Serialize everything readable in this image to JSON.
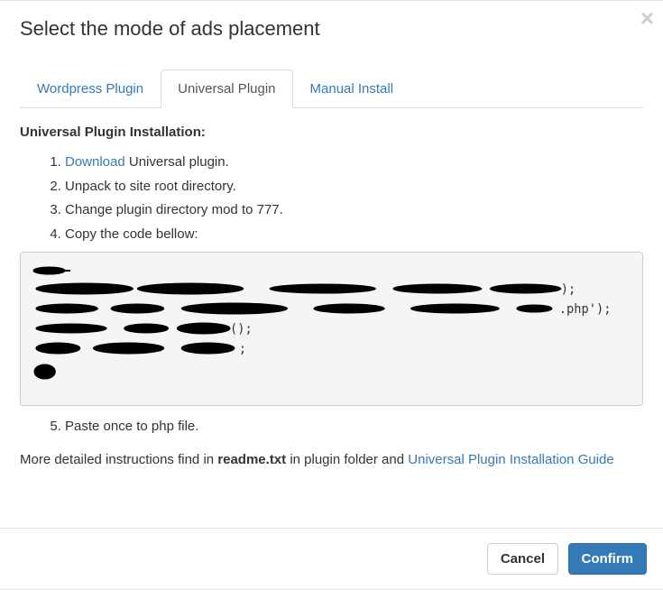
{
  "header": {
    "title": "Select the mode of ads placement",
    "close": "×"
  },
  "tabs": [
    {
      "label": "Wordpress Plugin",
      "active": false
    },
    {
      "label": "Universal Plugin",
      "active": true
    },
    {
      "label": "Manual Install",
      "active": false
    }
  ],
  "section": {
    "title": "Universal Plugin Installation:",
    "steps_pre": [
      {
        "prefix": "",
        "link": "Download",
        "suffix": " Universal plugin."
      },
      {
        "text": "Unpack to site root directory."
      },
      {
        "text": "Change plugin directory mod to 777."
      },
      {
        "text": "Copy the code bellow:"
      }
    ],
    "steps_post": [
      {
        "text": "Paste once to php file."
      }
    ],
    "detail_prefix": "More detailed instructions find in ",
    "detail_bold": "readme.txt",
    "detail_mid": " in plugin folder and ",
    "detail_link": "Universal Plugin Installation Guide"
  },
  "footer": {
    "cancel": "Cancel",
    "confirm": "Confirm"
  }
}
